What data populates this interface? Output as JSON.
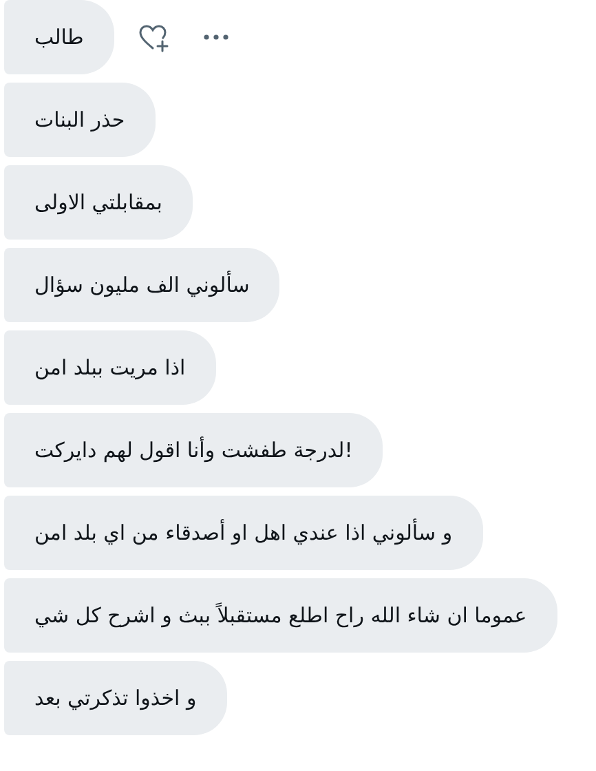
{
  "messages": [
    {
      "text": "طالب"
    },
    {
      "text": "حذر البنات"
    },
    {
      "text": "بمقابلتي الاولى"
    },
    {
      "text": "سألوني الف مليون سؤال"
    },
    {
      "text": "اذا مريت ببلد امن"
    },
    {
      "text": "لدرجة طفشت وأنا اقول لهم دايركت!"
    },
    {
      "text": "و سألوني اذا عندي اهل او أصدقاء من اي بلد امن"
    },
    {
      "text": "عموما ان شاء الله راح اطلع مستقبلاً ببث و اشرح كل شي"
    },
    {
      "text": "و اخذوا تذكرتي بعد"
    }
  ]
}
